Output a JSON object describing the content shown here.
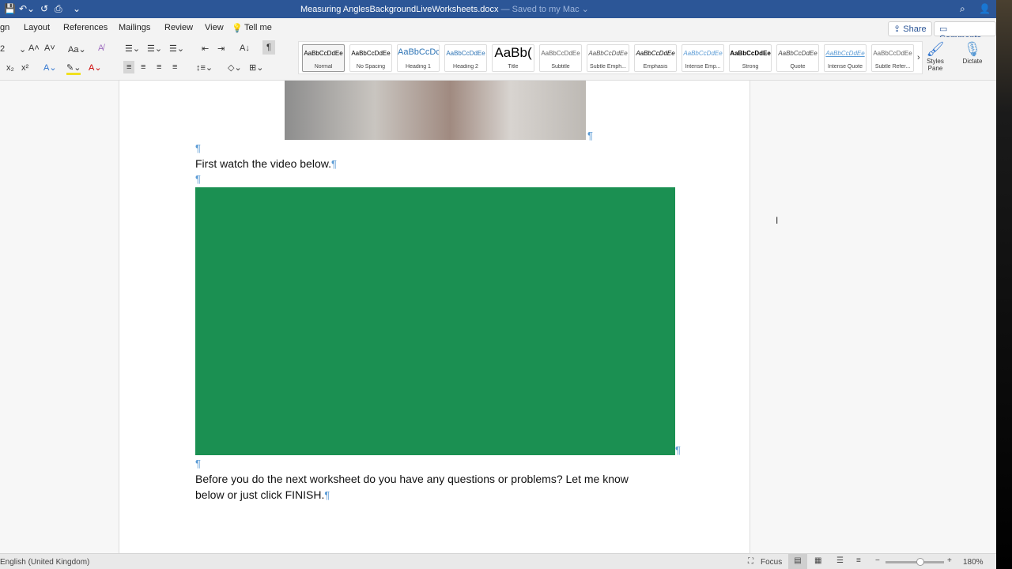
{
  "titlebar": {
    "document": "Measuring AnglesBackgroundLiveWorksheets.docx",
    "saved": "— Saved to my Mac ⌄"
  },
  "tabs": [
    "gn",
    "Layout",
    "References",
    "Mailings",
    "Review",
    "View"
  ],
  "tell_me": "Tell me",
  "share": "Share",
  "comments": "Comments",
  "font_size": "2",
  "styles": [
    {
      "preview": "AaBbCcDdEe",
      "name": "Normal"
    },
    {
      "preview": "AaBbCcDdEe",
      "name": "No Spacing"
    },
    {
      "preview": "AaBbCcDc",
      "name": "Heading 1"
    },
    {
      "preview": "AaBbCcDdEe",
      "name": "Heading 2"
    },
    {
      "preview": "AaBb(",
      "name": "Title"
    },
    {
      "preview": "AaBbCcDdEe",
      "name": "Subtitle"
    },
    {
      "preview": "AaBbCcDdEe",
      "name": "Subtle Emph..."
    },
    {
      "preview": "AaBbCcDdEe",
      "name": "Emphasis"
    },
    {
      "preview": "AaBbCcDdEe",
      "name": "Intense Emp..."
    },
    {
      "preview": "AaBbCcDdEe",
      "name": "Strong"
    },
    {
      "preview": "AaBbCcDdEe",
      "name": "Quote"
    },
    {
      "preview": "AaBbCcDdEe",
      "name": "Intense Quote"
    },
    {
      "preview": "AaBbCcDdEe",
      "name": "Subtle Refer..."
    }
  ],
  "styles_pane": "Styles Pane",
  "dictate": "Dictate",
  "document": {
    "pilcrow": "¶",
    "line1": "First watch the video below.",
    "line2a": "Before you do the next worksheet do you have any questions or problems? Let me know",
    "line2b": "below or just click FINISH.",
    "video_color": "#1b9052"
  },
  "status": {
    "language": "English (United Kingdom)",
    "focus": "Focus",
    "zoom": "180%",
    "zoom_level_percent": 180
  }
}
